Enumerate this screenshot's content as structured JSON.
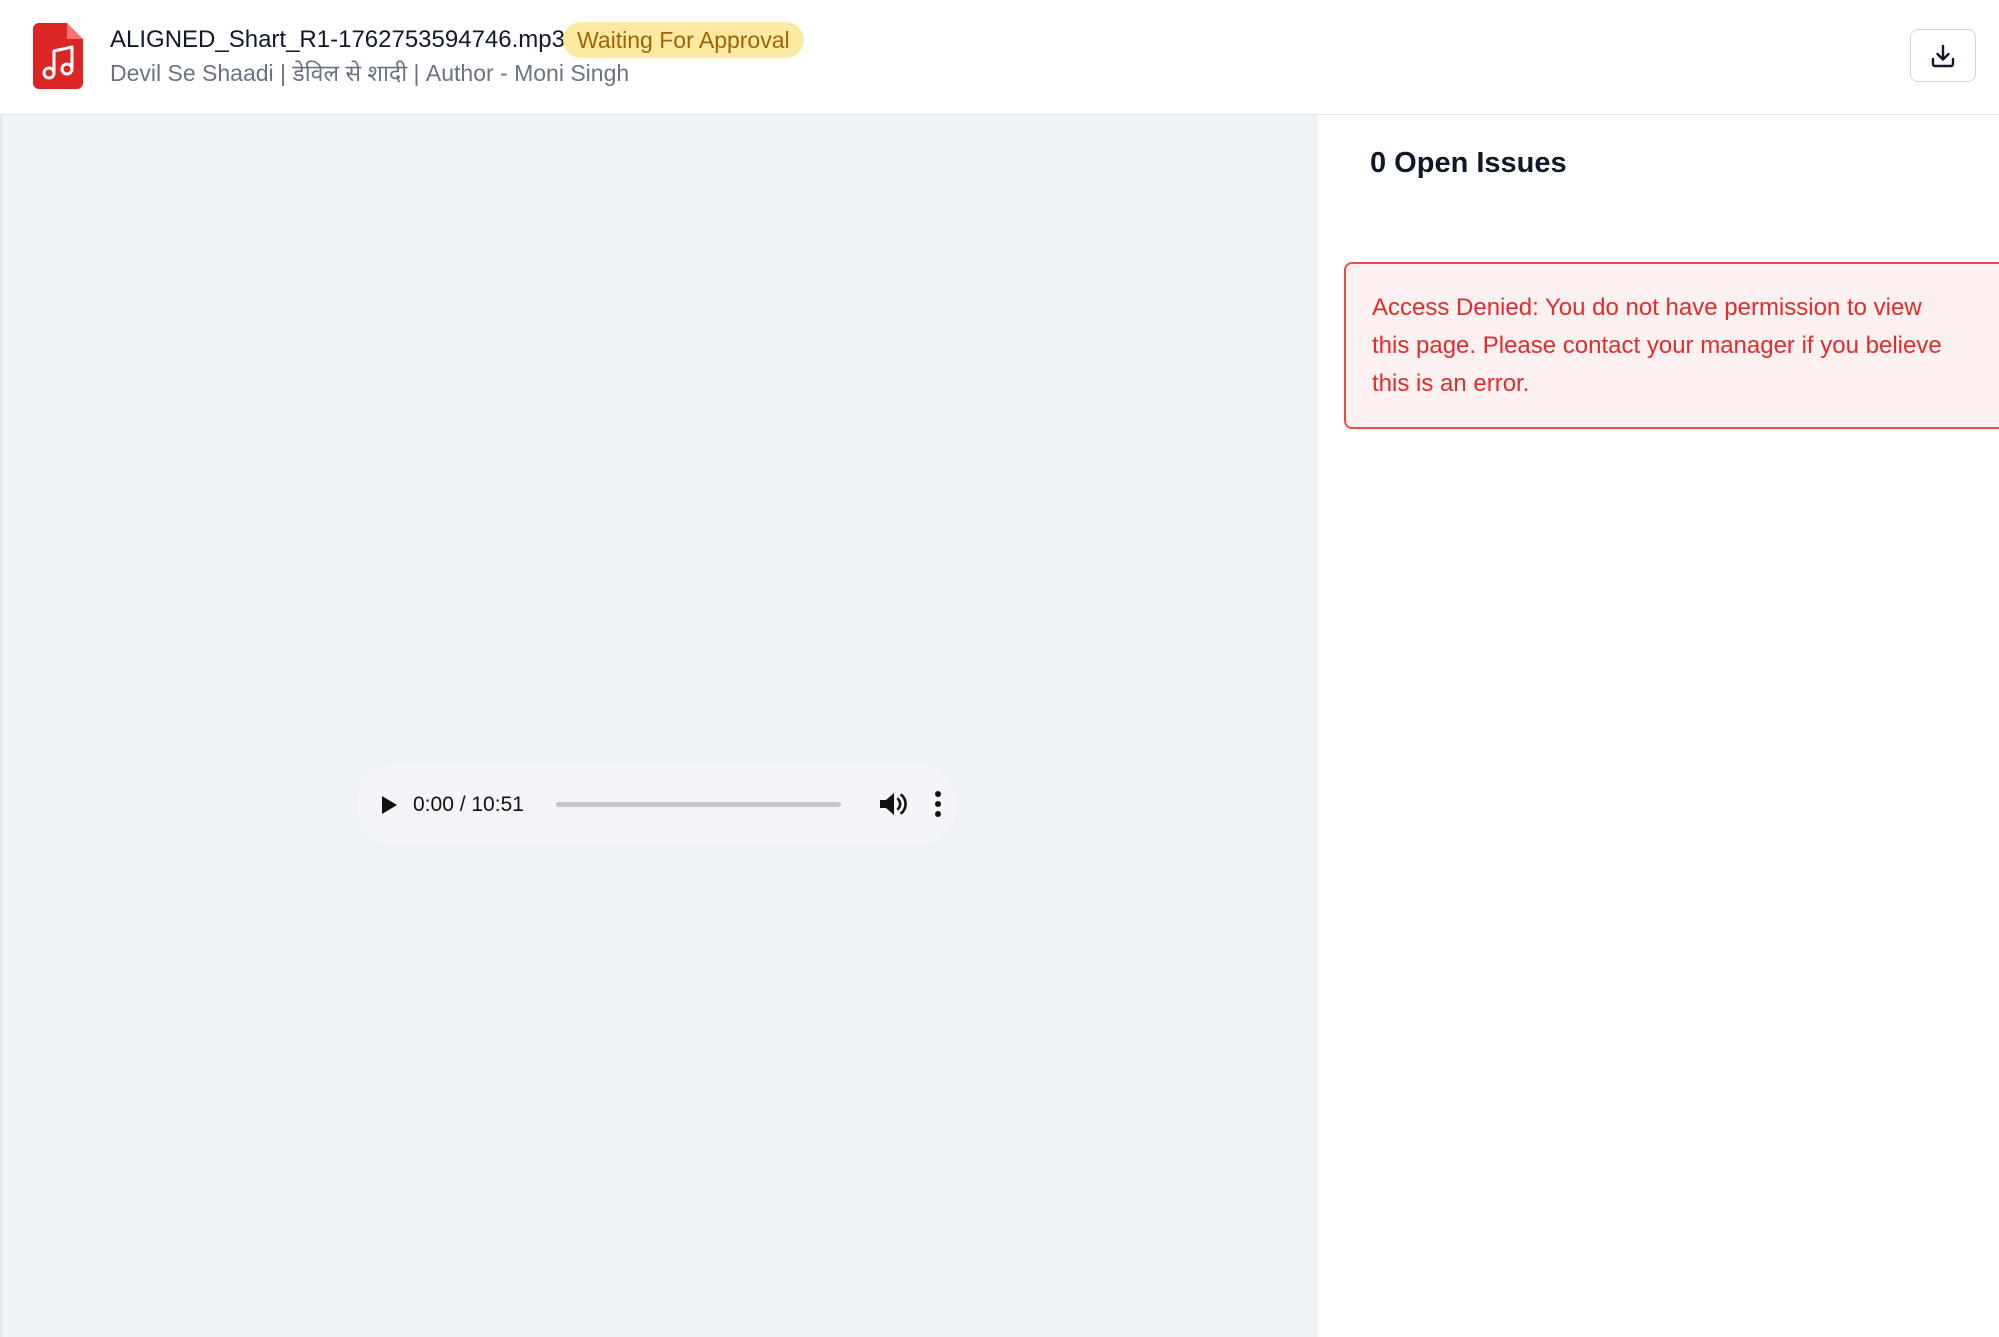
{
  "header": {
    "file_name": "ALIGNED_Shart_R1-1762753594746.mp3",
    "status": "Waiting For Approval",
    "subtitle": "Devil Se Shaadi | डेविल से शादी | Author - Moni Singh",
    "file_icon": "music-file-icon",
    "download_icon": "download-icon"
  },
  "player": {
    "time": "0:00 / 10:51",
    "progress": 0,
    "icons": {
      "play": "play-icon",
      "volume": "volume-icon",
      "more": "more-vertical-icon"
    }
  },
  "issues": {
    "title": "0 Open Issues",
    "alert_message": "Access Denied: You do not have permission to view this page. Please contact your manager if you believe this is an error."
  },
  "colors": {
    "accent_red": "#e02c2c",
    "badge_bg": "#fdeaa2",
    "badge_text": "#a16207",
    "player_bg": "#f0f3f7"
  }
}
